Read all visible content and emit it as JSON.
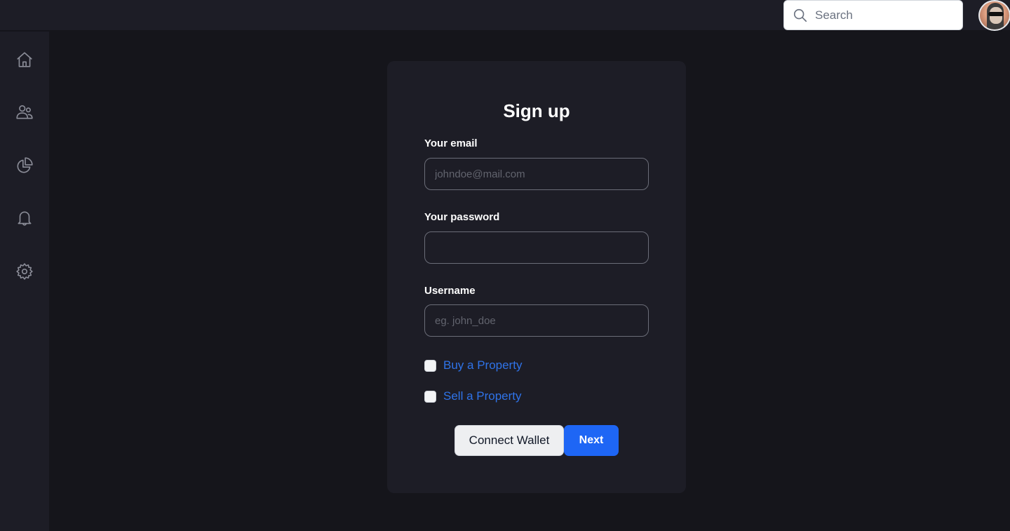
{
  "topbar": {
    "search": {
      "placeholder": "Search",
      "value": ""
    },
    "avatar_alt": "User avatar"
  },
  "sidebar": {
    "items": [
      {
        "name": "home",
        "icon": "home-icon"
      },
      {
        "name": "users",
        "icon": "users-icon"
      },
      {
        "name": "analytics",
        "icon": "pie-chart-icon"
      },
      {
        "name": "notifications",
        "icon": "bell-icon"
      },
      {
        "name": "settings",
        "icon": "gear-icon"
      }
    ]
  },
  "form": {
    "title": "Sign up",
    "email": {
      "label": "Your email",
      "placeholder": "johndoe@mail.com",
      "value": ""
    },
    "password": {
      "label": "Your password",
      "placeholder": "",
      "value": ""
    },
    "username": {
      "label": "Username",
      "placeholder": "eg. john_doe",
      "value": ""
    },
    "options": [
      {
        "label": "Buy a Property",
        "checked": false
      },
      {
        "label": "Sell a Property",
        "checked": false
      }
    ],
    "connect_wallet_label": "Connect Wallet",
    "next_label": "Next"
  },
  "colors": {
    "accent": "#1e66f5",
    "link": "#2f73e8",
    "background": "#15151b",
    "panel": "#1d1d26"
  }
}
